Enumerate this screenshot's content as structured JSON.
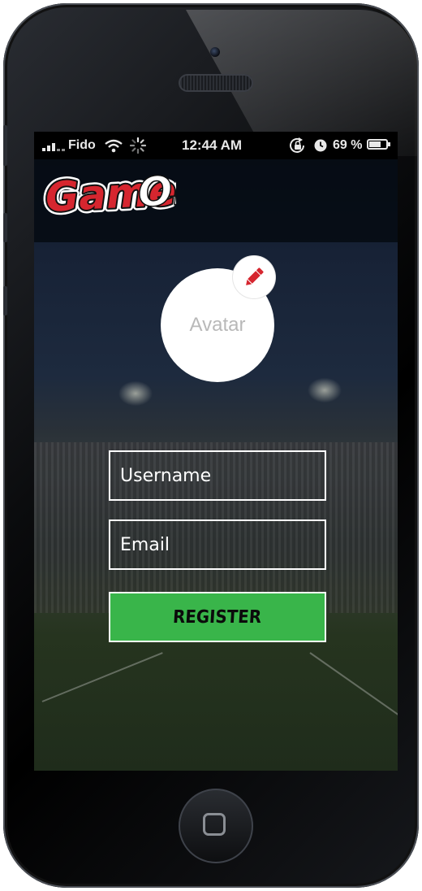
{
  "status_bar": {
    "carrier": "Fido",
    "time": "12:44 AM",
    "battery_percent": "69",
    "battery_level": 0.69,
    "percent_sign": "%"
  },
  "app": {
    "logo_text": "GameOn"
  },
  "profile": {
    "avatar_label": "Avatar",
    "edit_icon": "pencil-icon"
  },
  "form": {
    "username_placeholder": "Username",
    "email_placeholder": "Email",
    "register_label": "REGISTER"
  },
  "colors": {
    "accent_red": "#d6262f",
    "register_green": "#39b54a",
    "field_border": "#ffffff"
  }
}
